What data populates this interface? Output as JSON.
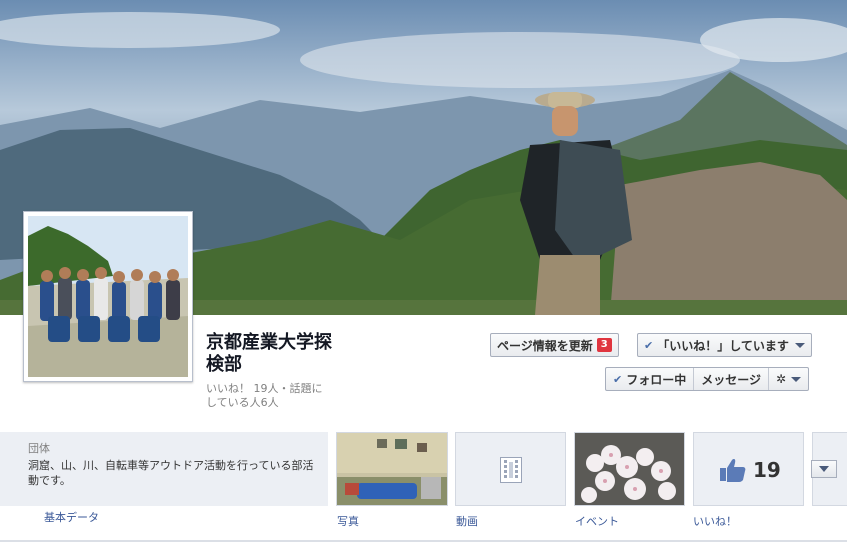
{
  "page": {
    "name": "京都産業大学探検部",
    "stats": "いいね！ 19人・話題にしている人6人"
  },
  "actions": {
    "update_info_label": "ページ情報を更新",
    "update_badge": "3",
    "liked_label": "「いいね！」しています",
    "following_label": "フォロー中",
    "message_label": "メッセージ",
    "settings_icon": "gear-icon"
  },
  "about": {
    "category": "団体",
    "description": "洞窟、山、川、自転車等アウトドア活動を行っている部活動です。",
    "label": "基本データ"
  },
  "apps": [
    {
      "label": "写真"
    },
    {
      "label": "動画"
    },
    {
      "label": "イベント"
    },
    {
      "label": "いいね！",
      "count": "19"
    }
  ],
  "colors": {
    "link": "#3b5998",
    "badge": "#e0353f",
    "tile_bg": "#eceff4"
  }
}
